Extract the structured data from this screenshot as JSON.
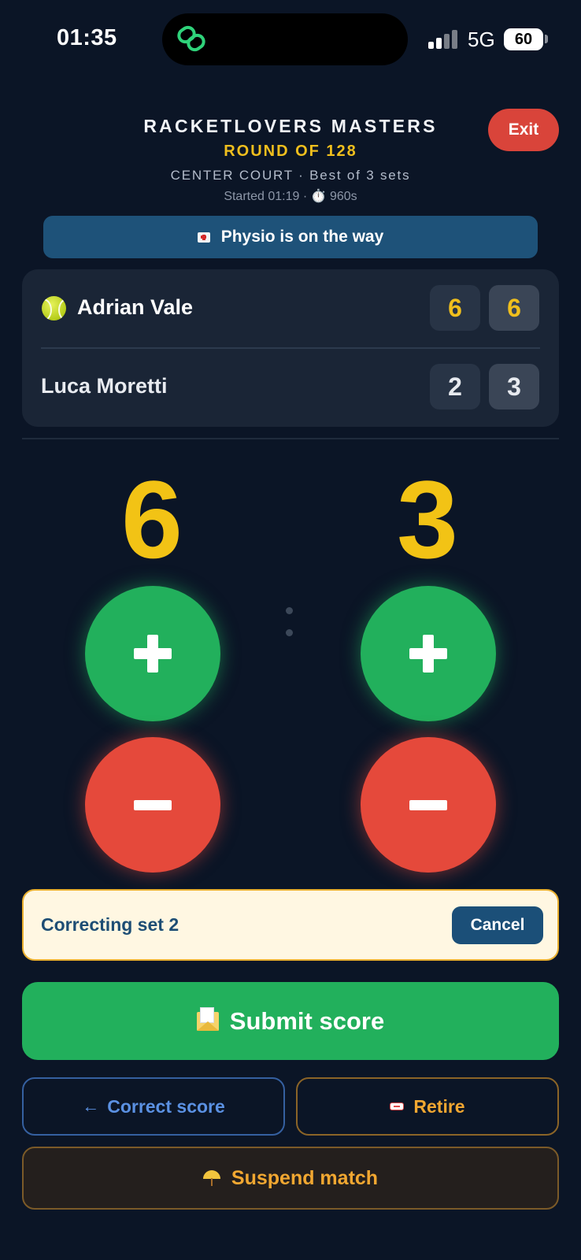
{
  "status_bar": {
    "time": "01:35",
    "network": "5G",
    "battery": "60"
  },
  "header": {
    "tournament": "RACKETLOVERS MASTERS",
    "round": "ROUND OF 128",
    "court_info": "CENTER COURT · Best of 3 sets",
    "started_info": "Started 01:19 · ⏱️ 960s",
    "exit_label": "Exit"
  },
  "notice": {
    "text": "Physio is on the way",
    "icon": "first-aid-icon"
  },
  "scoreboard": {
    "players": [
      {
        "name": "Adrian Vale",
        "serving": true,
        "sets": [
          "6",
          "6"
        ]
      },
      {
        "name": "Luca Moretti",
        "serving": false,
        "sets": [
          "2",
          "3"
        ]
      }
    ]
  },
  "current_set": {
    "left_score": "6",
    "right_score": "3"
  },
  "correction": {
    "text": "Correcting set 2",
    "cancel_label": "Cancel"
  },
  "actions": {
    "submit_label": "Submit score",
    "correct_label": "Correct score",
    "retire_label": "Retire",
    "suspend_label": "Suspend match"
  },
  "colors": {
    "background": "#0b1526",
    "accent_yellow": "#f2c315",
    "green": "#22b05c",
    "red": "#e5493b",
    "orange": "#f1a731",
    "blue": "#5b91e3"
  }
}
